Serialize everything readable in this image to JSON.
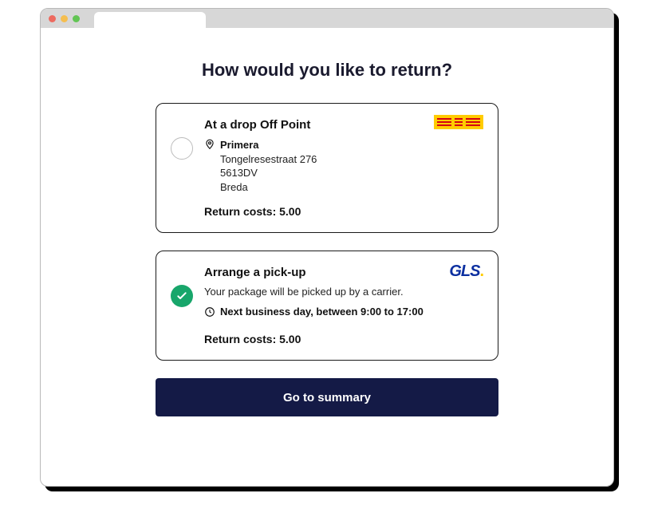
{
  "page": {
    "title": "How would you like to return?"
  },
  "options": [
    {
      "title": "At a drop Off Point",
      "selected": false,
      "carrier": "DHL",
      "location": {
        "name": "Primera",
        "street": "Tongelresestraat 276",
        "postal": "5613DV",
        "city": "Breda"
      },
      "cost_label": "Return costs: 5.00"
    },
    {
      "title": "Arrange a pick-up",
      "selected": true,
      "carrier": "GLS",
      "description": "Your package will be picked up by a carrier.",
      "slot": "Next business day, between 9:00 to 17:00",
      "cost_label": "Return costs: 5.00"
    }
  ],
  "cta": {
    "label": "Go to summary"
  },
  "logos": {
    "gls_text": "GLS",
    "gls_dot": "."
  }
}
